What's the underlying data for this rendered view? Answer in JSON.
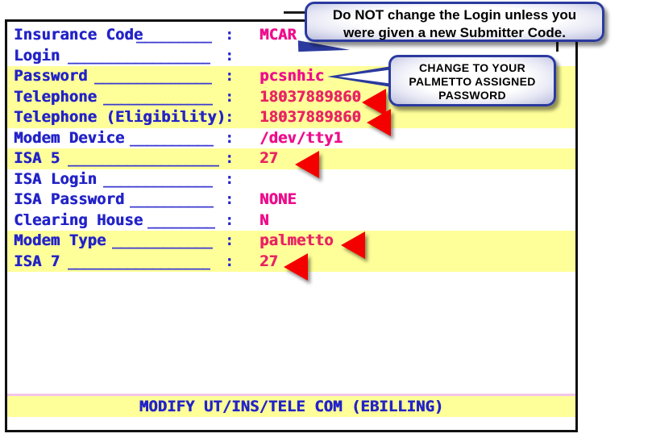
{
  "terminal": {
    "fields": [
      {
        "label": "Insurance Code",
        "fill": "_________",
        "colon": ":",
        "value": "MCAR",
        "highlight": false,
        "arrow": false
      },
      {
        "label": "Login",
        "fill": "_________________",
        "colon": ":",
        "value": "",
        "highlight": false,
        "arrow": false
      },
      {
        "label": "Password",
        "fill": "______________",
        "colon": ":",
        "value": "pcsnhic",
        "highlight": true,
        "arrow": false
      },
      {
        "label": "Telephone",
        "fill": "_____________",
        "colon": ":",
        "value": "18037889860",
        "highlight": true,
        "arrow": true
      },
      {
        "label": "Telephone (Eligibility)",
        "fill": "",
        "colon": ":",
        "value": "18037889860",
        "highlight": true,
        "arrow": true
      },
      {
        "label": "Modem Device",
        "fill": "__________",
        "colon": ":",
        "value": "/dev/tty1",
        "highlight": false,
        "arrow": false
      },
      {
        "label": "ISA 5",
        "fill": "__________________",
        "colon": ":",
        "value": "27",
        "highlight": true,
        "arrow": true
      },
      {
        "label": "ISA Login",
        "fill": "_____________",
        "colon": ":",
        "value": "",
        "highlight": false,
        "arrow": false
      },
      {
        "label": "ISA Password",
        "fill": "__________",
        "colon": ":",
        "value": "NONE",
        "highlight": false,
        "arrow": false
      },
      {
        "label": "Clearing House",
        "fill": "________",
        "colon": ":",
        "value": "N",
        "highlight": false,
        "arrow": false
      },
      {
        "label": "Modem Type",
        "fill": "____________",
        "colon": ":",
        "value": "palmetto",
        "highlight": true,
        "arrow": true
      },
      {
        "label": "ISA 7",
        "fill": "_________________",
        "colon": ":",
        "value": "27",
        "highlight": true,
        "arrow": true
      }
    ],
    "status_bar": "MODIFY UT/INS/TELE COM (EBILLING)"
  },
  "annotations": {
    "login_callout": {
      "line1": "Do NOT change the Login unless you",
      "line2": "were given a new Submitter Code."
    },
    "password_callout": {
      "line1": "CHANGE TO YOUR",
      "line2": "PALMETTO ASSIGNED",
      "line3": "PASSWORD"
    }
  },
  "colors": {
    "label": "#2323c8",
    "value": "#ee0d8c",
    "highlight": "#ffff99",
    "arrow": "#f50000",
    "callout_border": "#2b3a9e",
    "frame": "#111111"
  }
}
